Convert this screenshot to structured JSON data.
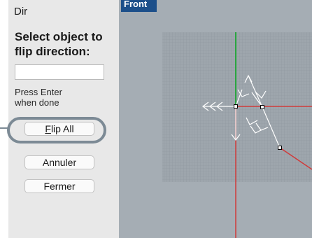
{
  "panel": {
    "title": "Dir",
    "prompt": "Select object to flip direction:",
    "input_value": "",
    "hint": "Press Enter\nwhen done",
    "buttons": {
      "flip_all": {
        "mnemonic": "F",
        "rest": "lip All"
      },
      "cancel": "Annuler",
      "close": "Fermer"
    }
  },
  "viewport": {
    "tab_label": "Front"
  },
  "colors": {
    "viewport_bg": "#a5adb4",
    "grid_bg": "#9ea6ad",
    "grid_line": "#8e969d",
    "axis_x": "#d03a3a",
    "axis_y": "#2aa640",
    "arrows": "#ffffff",
    "highlight": "#7c8a95",
    "tab_bg": "#1c4f8a"
  }
}
